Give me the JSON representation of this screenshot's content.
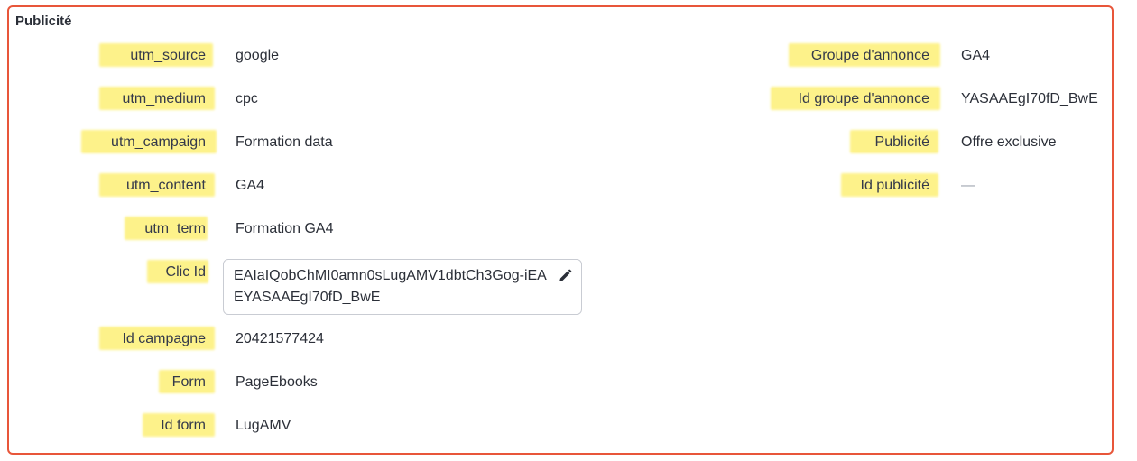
{
  "section": {
    "title": "Publicité"
  },
  "left_fields": [
    {
      "label": "utm_source",
      "value": "google"
    },
    {
      "label": "utm_medium",
      "value": "cpc"
    },
    {
      "label": "utm_campaign",
      "value": "Formation data"
    },
    {
      "label": "utm_content",
      "value": "GA4"
    },
    {
      "label": "utm_term",
      "value": "Formation GA4"
    },
    {
      "label": "Clic Id",
      "value": "EAIaIQobChMI0amn0sLugAMV1dbtCh3Gog-iEAEYASAAEgI70fD_BwE"
    },
    {
      "label": "Id campagne",
      "value": "20421577424"
    },
    {
      "label": "Form",
      "value": "PageEbooks"
    },
    {
      "label": "Id form",
      "value": "LugAMV"
    }
  ],
  "right_fields": [
    {
      "label": "Groupe d'annonce",
      "value": "GA4"
    },
    {
      "label": "Id groupe d'annonce",
      "value": "YASAAEgI70fD_BwE"
    },
    {
      "label": "Publicité",
      "value": "Offre exclusive"
    },
    {
      "label": "Id publicité",
      "value": "—"
    }
  ],
  "colors": {
    "border": "#e8563a",
    "highlight": "#fdf28a",
    "text": "#2b2f38"
  },
  "icons": {
    "edit": "pencil-icon"
  }
}
